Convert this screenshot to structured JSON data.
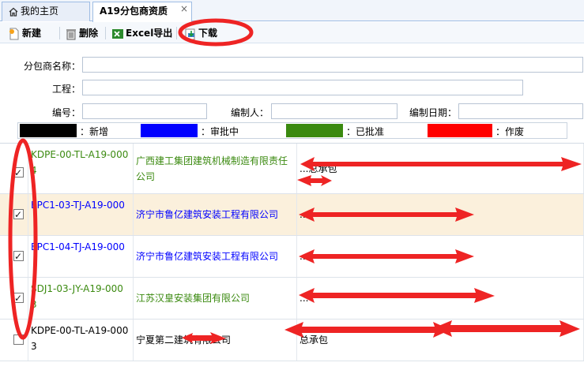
{
  "tabs": [
    {
      "label": "我的主页",
      "icon": "home-icon"
    },
    {
      "label": "A19分包商资质",
      "close": "×"
    }
  ],
  "toolbar": {
    "new_label": "新建",
    "delete_label": "删除",
    "excel_label": "Excel导出",
    "download_label": "下载"
  },
  "form": {
    "name_label": "分包商名称：",
    "project_label": "工程：",
    "code_label": "编号：",
    "author_label": "编制人：",
    "date_label": "编制日期："
  },
  "legend": [
    {
      "color": "#000000",
      "label": "：新增"
    },
    {
      "color": "#0000ff",
      "label": "：审批中"
    },
    {
      "color": "#3b8a10",
      "label": "：已批准"
    },
    {
      "color": "#ff0000",
      "label": "：作废"
    }
  ],
  "rows": [
    {
      "code": "KDPE-00-TL-A19-000 4",
      "name": "广西建工集团建筑机械制造有限责任公司",
      "scope": "...总承包",
      "color": "#3b8a10",
      "checked": true
    },
    {
      "code": "EPC1-03-TJ-A19-000",
      "name": "济宁市鲁亿建筑安装工程有限公司",
      "scope": "...",
      "color": "#0000ff",
      "checked": true
    },
    {
      "code": "EPC1-04-TJ-A19-000",
      "name": "济宁市鲁亿建筑安装工程有限公司",
      "scope": "...",
      "color": "#0000ff",
      "checked": true
    },
    {
      "code": "SDJ1-03-JY-A19-000 3",
      "name": "江苏汉皇安装集团有限公司",
      "scope": "...",
      "color": "#3b8a10",
      "checked": true
    },
    {
      "code": "KDPE-00-TL-A19-000 3",
      "name": "宁夏第二建筑有限公司",
      "scope": "总承包",
      "color": "#000000",
      "checked": false
    }
  ]
}
